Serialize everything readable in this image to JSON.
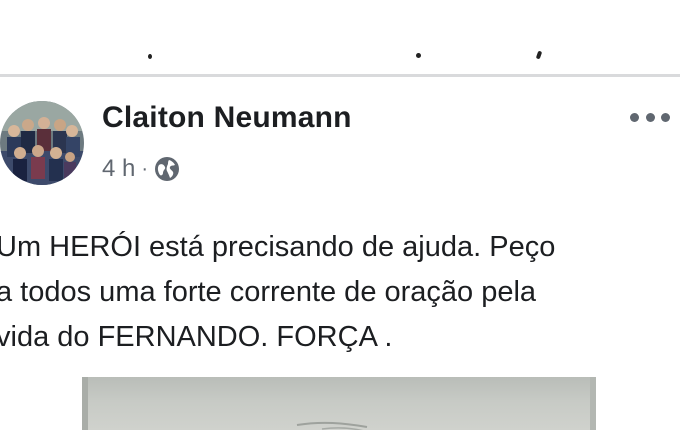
{
  "post": {
    "author": "Claiton Neumann",
    "time": "4 h",
    "separator": "·",
    "privacy_icon": "globe-icon",
    "more_icon": "more-options-icon",
    "text": "Um HERÓI está precisando de ajuda. Peço\na todos uma forte corrente de oração pela\nvida do FERNANDO. FORÇA ."
  },
  "colors": {
    "name": "#1c1e21",
    "meta": "#606770",
    "divider": "#d9dadc"
  }
}
